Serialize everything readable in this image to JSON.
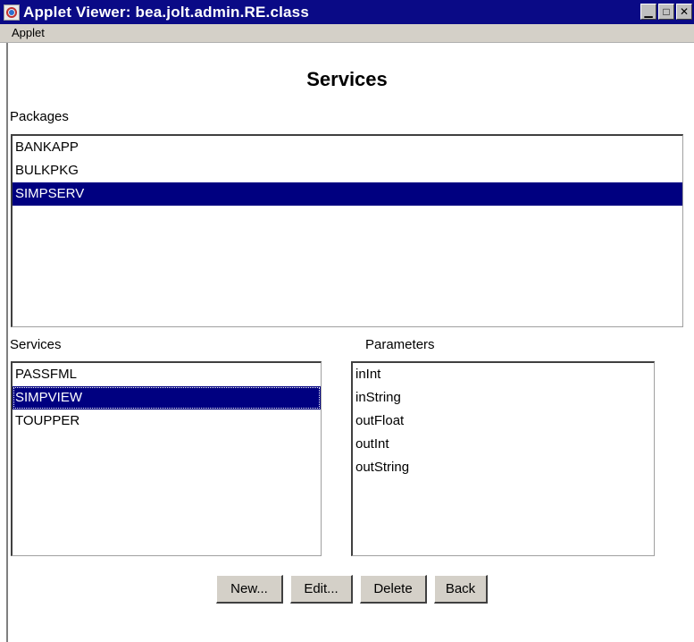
{
  "window": {
    "title": "Applet Viewer: bea.jolt.admin.RE.class",
    "minimize_glyph": "▁",
    "maximize_glyph": "□",
    "close_glyph": "✕"
  },
  "menu": {
    "items": [
      "Applet"
    ]
  },
  "page": {
    "title": "Services"
  },
  "packages": {
    "label": "Packages",
    "items": [
      "BANKAPP",
      "BULKPKG",
      "SIMPSERV"
    ],
    "selected_index": 2
  },
  "services": {
    "label": "Services",
    "items": [
      "PASSFML",
      "SIMPVIEW",
      "TOUPPER"
    ],
    "selected_index": 1
  },
  "parameters": {
    "label": "Parameters",
    "items": [
      "inInt",
      "inString",
      "outFloat",
      "outInt",
      "outString"
    ]
  },
  "buttons": {
    "new": "New...",
    "edit": "Edit...",
    "delete": "Delete",
    "back": "Back"
  },
  "colors": {
    "titlebar": "#0a0a86",
    "selection": "#000080",
    "menubar": "#d4d0c8",
    "button_face": "#d4d0c8"
  }
}
